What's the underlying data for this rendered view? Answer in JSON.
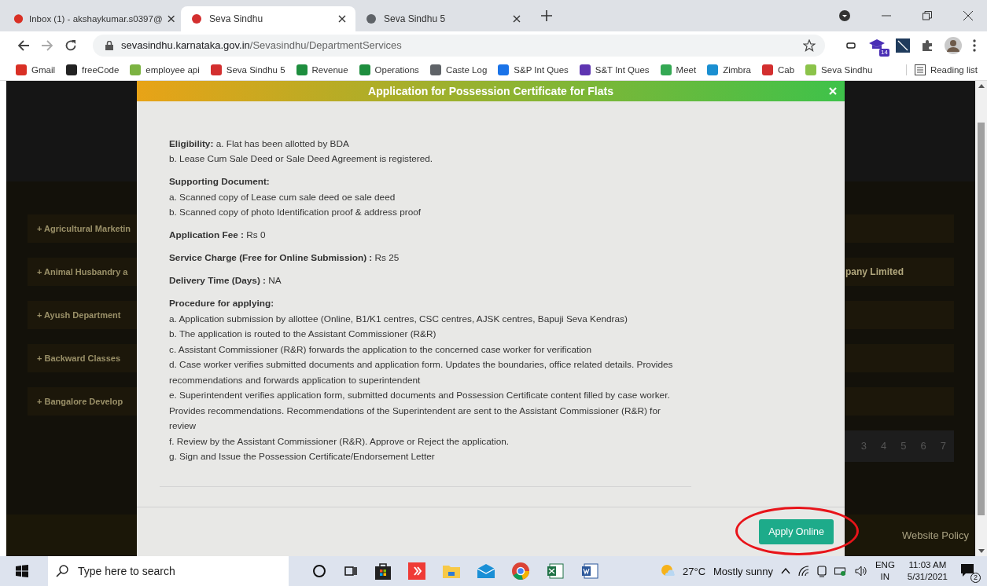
{
  "browser": {
    "tabs": [
      {
        "title": "Inbox (1) - akshaykumar.s0397@",
        "selected": false
      },
      {
        "title": "Seva Sindhu",
        "selected": true
      },
      {
        "title": "Seva Sindhu 5",
        "selected": false
      }
    ],
    "address": {
      "domain": "sevasindhu.karnataka.gov.in",
      "path": "/Sevasindhu/DepartmentServices"
    },
    "extension_badge": "14",
    "bookmarks": [
      "Gmail",
      "freeCode",
      "employee api",
      "Seva Sindhu 5",
      "Revenue",
      "Operations",
      "Caste Log",
      "S&P Int Ques",
      "S&T Int Ques",
      "Meet",
      "Zimbra",
      "Cab",
      "Seva Sindhu"
    ],
    "reading_list": "Reading list"
  },
  "page": {
    "departments_left": [
      "+ Agricultural Marketin",
      "+ Animal Husbandry a",
      "+ Ayush Department",
      "+ Backward Classes",
      "+ Bangalore Develop"
    ],
    "department_right_text": "pany Limited",
    "pagination": [
      "3",
      "4",
      "5",
      "6",
      "7"
    ],
    "footer_link": "Website Policy"
  },
  "modal": {
    "title": "Application for Possession Certificate for Flats",
    "blocks": [
      {
        "lines": [
          "**Eligibility:** a. Flat has been allotted by BDA",
          "b. Lease Cum Sale Deed or Sale Deed Agreement is registered."
        ]
      },
      {
        "heading": "Supporting Document:",
        "lines": [
          "a. Scanned copy of Lease cum sale deed oe sale deed",
          "b. Scanned copy of photo Identification proof & address proof"
        ]
      },
      {
        "lines": [
          "**Application Fee :** Rs 0"
        ]
      },
      {
        "lines": [
          "**Service Charge (Free for Online Submission) :** Rs 25"
        ]
      },
      {
        "lines": [
          "**Delivery Time (Days) :** NA"
        ]
      },
      {
        "heading": "Procedure for applying:",
        "lines": [
          "a. Application submission by allottee (Online, B1/K1 centres, CSC centres, AJSK centres, Bapuji Seva Kendras)",
          "b. The application is routed to the Assistant Commissioner (R&R)",
          "c. Assistant Commissioner (R&R) forwards the application to the concerned case worker for verification",
          "d. Case worker verifies submitted documents and application form. Updates the boundaries, office related details. Provides recommendations and forwards application to superintendent",
          "e. Superintendent verifies application form, submitted documents and Possession Certificate content filled by case worker. Provides recommendations. Recommendations of the Superintendent are sent to the Assistant Commissioner (R&R) for review",
          "f. Review by the Assistant Commissioner (R&R). Approve or Reject the application.",
          "g. Sign and Issue the Possession Certificate/Endorsement Letter"
        ]
      }
    ],
    "apply_button": "Apply Online",
    "highlighted": true
  },
  "taskbar": {
    "search_placeholder": "Type here to search",
    "temperature": "27°C",
    "weather": "Mostly sunny",
    "language": "ENG",
    "region": "IN",
    "time": "11:03 AM",
    "date": "5/31/2021",
    "notifications": "2"
  }
}
